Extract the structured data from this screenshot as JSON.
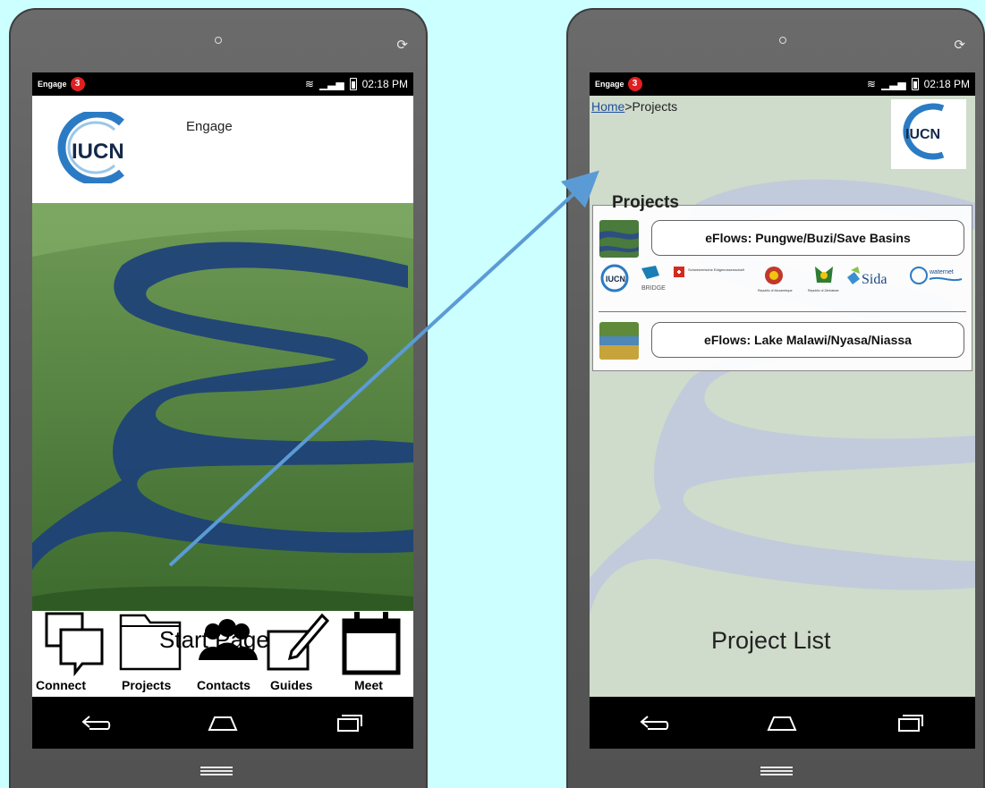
{
  "status_bar": {
    "app_name": "Engage",
    "badge": "3",
    "time": "02:18 PM"
  },
  "start_page": {
    "logo_text": "IUCN",
    "app_title": "Engage",
    "caption": "Start Page",
    "nav": [
      {
        "label": "Connect",
        "icon": "chat-bubbles-icon"
      },
      {
        "label": "Projects",
        "icon": "folder-icon"
      },
      {
        "label": "Contacts",
        "icon": "people-icon"
      },
      {
        "label": "Guides",
        "icon": "edit-icon"
      },
      {
        "label": "Meet",
        "icon": "calendar-icon"
      }
    ]
  },
  "project_list": {
    "breadcrumb_home": "Home",
    "breadcrumb_sep": ">",
    "breadcrumb_current": "Projects",
    "logo_text": "IUCN",
    "section_title": "Projects",
    "projects": [
      {
        "name": "eFlows: Pungwe/Buzi/Save Basins"
      },
      {
        "name": "eFlows: Lake Malawi/Nyasa/Niassa"
      }
    ],
    "sponsors": [
      "IUCN",
      "BRIDGE",
      "Schweizerische Eidgenossenschaft",
      "Republic of Mozambique",
      "Republic of Zimbabwe",
      "Sida",
      "waternet"
    ],
    "caption": "Project List"
  },
  "colors": {
    "background": "#ccffff",
    "arrow": "#5b9bd5",
    "badge": "#e02020",
    "link": "#1f4fa0"
  }
}
